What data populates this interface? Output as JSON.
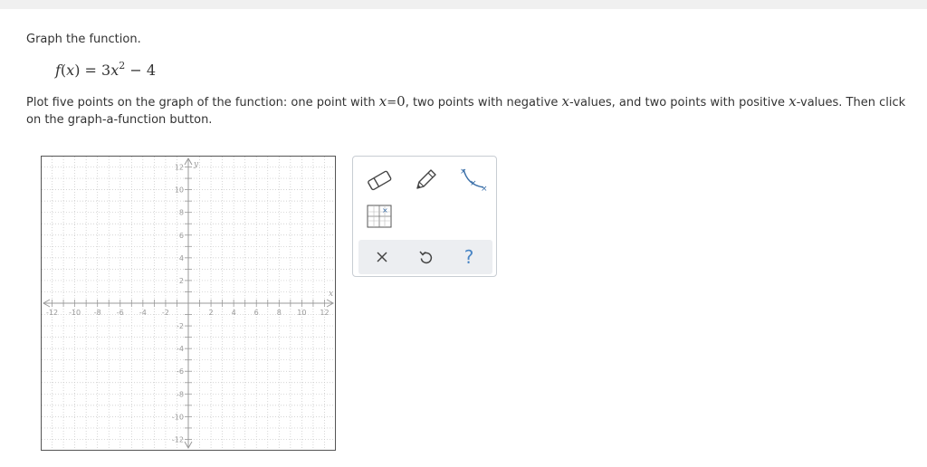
{
  "problem": {
    "title": "Graph the function.",
    "function": {
      "name": "f",
      "var": "x",
      "coef": "3",
      "exp": "2",
      "const": "4"
    },
    "instruction_parts": [
      "Plot five points on the graph of the function: one point with ",
      "x",
      "=",
      "0",
      ", two points with negative ",
      "x",
      "-values, and two points with positive ",
      "x",
      "-values. Then click on the graph-a-function button."
    ]
  },
  "graph": {
    "x_range": [
      -13,
      13
    ],
    "y_range": [
      -13,
      13
    ],
    "tick_step": 1,
    "x_tick_labels": [
      "-12",
      "-10",
      "-8",
      "-6",
      "-4",
      "-2",
      "2",
      "4",
      "6",
      "8",
      "10",
      "12"
    ],
    "y_tick_labels": [
      "12",
      "10",
      "8",
      "6",
      "4",
      "2",
      "-2",
      "-4",
      "-6",
      "-8",
      "-10",
      "-12"
    ],
    "x_axis_label": "x",
    "y_axis_label": "y",
    "grid": "dotted"
  },
  "tools": [
    {
      "name": "eraser-tool",
      "icon": "eraser-icon"
    },
    {
      "name": "pencil-tool",
      "icon": "pencil-icon"
    },
    {
      "name": "graph-function-tool",
      "icon": "curve-points-icon"
    },
    {
      "name": "point-plot-tool",
      "icon": "plot-points-icon"
    }
  ],
  "toolbar": {
    "clear_icon": "close-icon",
    "undo_icon": "undo-icon",
    "help_label": "?"
  },
  "colors": {
    "accent": "#4a86c5",
    "grid": "#c5c5c5",
    "axis": "#999999"
  }
}
